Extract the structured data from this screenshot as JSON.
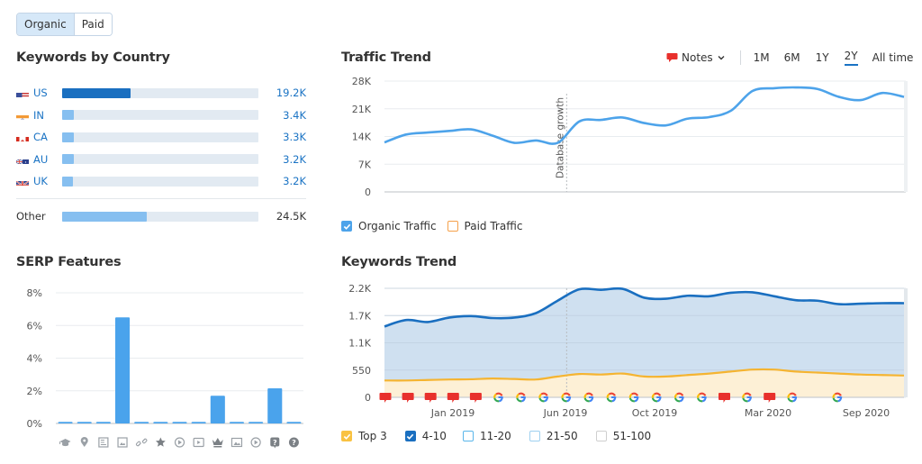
{
  "toggle": {
    "options": [
      "Organic",
      "Paid"
    ],
    "active": "Organic"
  },
  "keywords_by_country": {
    "title": "Keywords by Country",
    "rows": [
      {
        "code": "US",
        "flag": "us-flag",
        "value": "19.2K",
        "fraction": 0.35,
        "bar_color": "#1a6fc0"
      },
      {
        "code": "IN",
        "flag": "in-flag",
        "value": "3.4K",
        "fraction": 0.06,
        "bar_color": "#86bff0"
      },
      {
        "code": "CA",
        "flag": "ca-flag",
        "value": "3.3K",
        "fraction": 0.06,
        "bar_color": "#86bff0"
      },
      {
        "code": "AU",
        "flag": "au-flag",
        "value": "3.2K",
        "fraction": 0.06,
        "bar_color": "#86bff0"
      },
      {
        "code": "UK",
        "flag": "uk-flag",
        "value": "3.2K",
        "fraction": 0.055,
        "bar_color": "#86bff0"
      }
    ],
    "other": {
      "label": "Other",
      "value": "24.5K",
      "fraction": 0.43,
      "bar_color": "#86bff0"
    }
  },
  "serp_features": {
    "title": "SERP Features",
    "icons": [
      "graduation-cap-icon",
      "map-pin-icon",
      "news-icon",
      "image-pack-icon",
      "link-icon",
      "star-icon",
      "video-icon",
      "video-carousel-icon",
      "crown-icon",
      "image-icon",
      "play-icon",
      "faq-icon",
      "question-icon"
    ]
  },
  "traffic_trend": {
    "title": "Traffic Trend",
    "notes_label": "Notes",
    "periods": [
      "1M",
      "6M",
      "1Y",
      "2Y",
      "All time"
    ],
    "active_period": "2Y",
    "annotation": "Database growth",
    "legend": [
      {
        "label": "Organic Traffic",
        "checked": true,
        "color": "#4da3ea"
      },
      {
        "label": "Paid Traffic",
        "checked": false,
        "color": "#f5a04a"
      }
    ]
  },
  "keywords_trend": {
    "title": "Keywords Trend",
    "legend": [
      {
        "label": "Top 3",
        "checked": true,
        "color": "#f9c242"
      },
      {
        "label": "4-10",
        "checked": true,
        "color": "#1a6fc0"
      },
      {
        "label": "11-20",
        "checked": false,
        "color": "#5ab6ea"
      },
      {
        "label": "21-50",
        "checked": false,
        "color": "#9fd0f0"
      },
      {
        "label": "51-100",
        "checked": false,
        "color": "#cfcfcf"
      }
    ],
    "markers": [
      "note",
      "note",
      "note",
      "note",
      "note",
      "google",
      "google",
      "google",
      "google",
      "google",
      "google",
      "google",
      "google",
      "google",
      "google",
      "note",
      "google",
      "note",
      "google",
      "google"
    ]
  },
  "chart_data": [
    {
      "type": "bar",
      "title": "SERP Features",
      "categories": [
        "Featured snippet (academic)",
        "Local pack",
        "Top stories",
        "Image pack",
        "Sitelinks",
        "Reviews",
        "Video",
        "Featured video",
        "Top ad / knowledge",
        "Thumbnail",
        "Video carousel",
        "FAQ",
        "People also ask"
      ],
      "values": [
        0.1,
        0.1,
        0.1,
        6.5,
        0.1,
        0.1,
        0.1,
        0.1,
        1.7,
        0.1,
        0.1,
        2.15,
        0.1
      ],
      "ylabel": "",
      "yticks": [
        "0%",
        "2%",
        "4%",
        "6%",
        "8%"
      ],
      "ylim": [
        0,
        8
      ],
      "grid": true,
      "color": "#4aa3ec"
    },
    {
      "type": "line",
      "title": "Traffic Trend",
      "x": [
        "2018-10",
        "2018-11",
        "2018-12",
        "2019-01",
        "2019-02",
        "2019-03",
        "2019-04",
        "2019-05",
        "2019-06",
        "2019-07",
        "2019-08",
        "2019-09",
        "2019-10",
        "2019-11",
        "2019-12",
        "2020-01",
        "2020-02",
        "2020-03",
        "2020-04",
        "2020-05",
        "2020-06",
        "2020-07",
        "2020-08",
        "2020-09",
        "2020-10"
      ],
      "series": [
        {
          "name": "Organic Traffic",
          "values": [
            12500,
            14500,
            15000,
            15400,
            15800,
            14200,
            12400,
            13000,
            12400,
            17800,
            18200,
            18800,
            17400,
            16800,
            18500,
            18900,
            20500,
            25500,
            26200,
            26400,
            26000,
            24000,
            23200,
            25000,
            24000
          ],
          "color": "#4da3ea"
        }
      ],
      "yticks": [
        "0",
        "7K",
        "14K",
        "21K",
        "28K"
      ],
      "ylim": [
        0,
        28000
      ],
      "annotations": [
        {
          "x": "2019-06",
          "label": "Database growth"
        }
      ],
      "grid": true,
      "legend": "bottom-left"
    },
    {
      "type": "area",
      "title": "Keywords Trend",
      "x": [
        "2018-10",
        "2018-11",
        "2018-12",
        "2019-01",
        "2019-02",
        "2019-03",
        "2019-04",
        "2019-05",
        "2019-06",
        "2019-07",
        "2019-08",
        "2019-09",
        "2019-10",
        "2019-11",
        "2019-12",
        "2020-01",
        "2020-02",
        "2020-03",
        "2020-04",
        "2020-05",
        "2020-06",
        "2020-07",
        "2020-08",
        "2020-09",
        "2020-10"
      ],
      "xtick_labels": [
        "Jan 2019",
        "Jun 2019",
        "Oct 2019",
        "Mar 2020",
        "Sep 2020"
      ],
      "series": [
        {
          "name": "4-10",
          "values": [
            1430,
            1560,
            1520,
            1610,
            1640,
            1600,
            1610,
            1700,
            1950,
            2180,
            2170,
            2190,
            2010,
            1990,
            2050,
            2040,
            2110,
            2120,
            2040,
            1960,
            1950,
            1880,
            1890,
            1900,
            1900
          ],
          "color": "#1a6fc0"
        },
        {
          "name": "Top 3",
          "values": [
            340,
            340,
            350,
            360,
            365,
            380,
            370,
            360,
            420,
            470,
            460,
            480,
            420,
            420,
            450,
            480,
            520,
            560,
            560,
            520,
            500,
            480,
            460,
            450,
            440
          ],
          "color": "#f5b431"
        }
      ],
      "yticks": [
        "0",
        "550",
        "1.1K",
        "1.7K",
        "2.2K"
      ],
      "ylim": [
        0,
        2200
      ],
      "grid": true,
      "legend": "bottom-left"
    }
  ]
}
